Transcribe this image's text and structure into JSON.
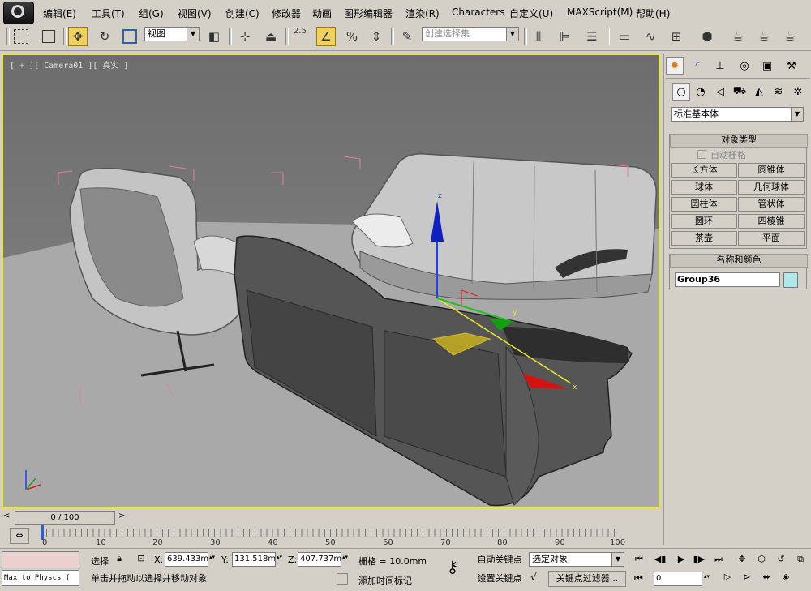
{
  "menu": [
    "编辑(E)",
    "工具(T)",
    "组(G)",
    "视图(V)",
    "创建(C)",
    "修改器",
    "动画",
    "图形编辑器",
    "渲染(R)",
    "Characters",
    "自定义(U)",
    "MAXScript(M)",
    "帮助(H)"
  ],
  "toolbar": {
    "view_dropdown": "视图",
    "snap_value": "2.5",
    "selection_set_placeholder": "创建选择集"
  },
  "viewport": {
    "label": "[ + ][ Camera01 ][ 真实 ]",
    "gizmo_x": "x",
    "gizmo_y": "y",
    "gizmo_z": "z"
  },
  "timeline": {
    "frame_display": "0 / 100",
    "prev_arrow": "<",
    "next_arrow": ">",
    "ticks": [
      "0",
      "10",
      "20",
      "30",
      "40",
      "50",
      "60",
      "70",
      "80",
      "90",
      "100"
    ]
  },
  "command_panel": {
    "category_dropdown": "标准基本体",
    "object_type_title": "对象类型",
    "autogrid_label": "自动栅格",
    "object_buttons": [
      "长方体",
      "圆锥体",
      "球体",
      "几何球体",
      "圆柱体",
      "管状体",
      "圆环",
      "四棱锥",
      "茶壶",
      "平面"
    ],
    "name_color_title": "名称和颜色",
    "object_name": "Group36",
    "object_color": "#aee8e8"
  },
  "status": {
    "maxscript_listener": "Max to Physcs (",
    "selection_label": "选择",
    "x_label": "X:",
    "x_value": "639.433mm",
    "y_label": "Y:",
    "y_value": "131.518mm",
    "z_label": "Z:",
    "z_value": "407.737mm",
    "grid_label": "栅格 = 10.0mm",
    "prompt": "单击并拖动以选择并移动对象",
    "add_time_tag": "添加时间标记",
    "auto_key": "自动关键点",
    "set_key": "设置关键点",
    "key_mode_dropdown": "选定对象",
    "key_filters": "关键点过滤器...",
    "current_frame": "0"
  }
}
